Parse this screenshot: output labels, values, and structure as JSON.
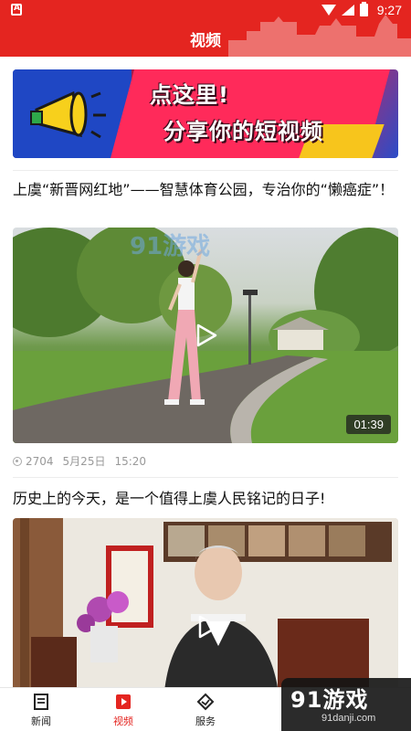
{
  "status_bar": {
    "time": "9:27"
  },
  "header": {
    "title": "视频"
  },
  "banner": {
    "line1": "点这里!",
    "line2": "分享你的短视频"
  },
  "articles": [
    {
      "title": "上虞“新晋网红地”——智慧体育公园，专治你的“懒癌症”！",
      "duration": "01:39",
      "views": "2704",
      "date": "5月25日",
      "time": "15:20"
    },
    {
      "title": "历史上的今天，是一个值得上虞人民铭记的日子!"
    }
  ],
  "tabs": [
    {
      "label": "新闻",
      "icon": "news-icon"
    },
    {
      "label": "视频",
      "icon": "video-icon"
    },
    {
      "label": "服务",
      "icon": "service-icon"
    },
    {
      "label": "",
      "icon": ""
    },
    {
      "label": "",
      "icon": ""
    }
  ],
  "active_tab": "视频",
  "watermark": {
    "mid_text": "91游戏",
    "corner_text": "91游戏",
    "corner_url": "91danji.com"
  },
  "colors": {
    "brand_red": "#e42520",
    "text_dark": "#111111",
    "meta_gray": "#999999"
  }
}
